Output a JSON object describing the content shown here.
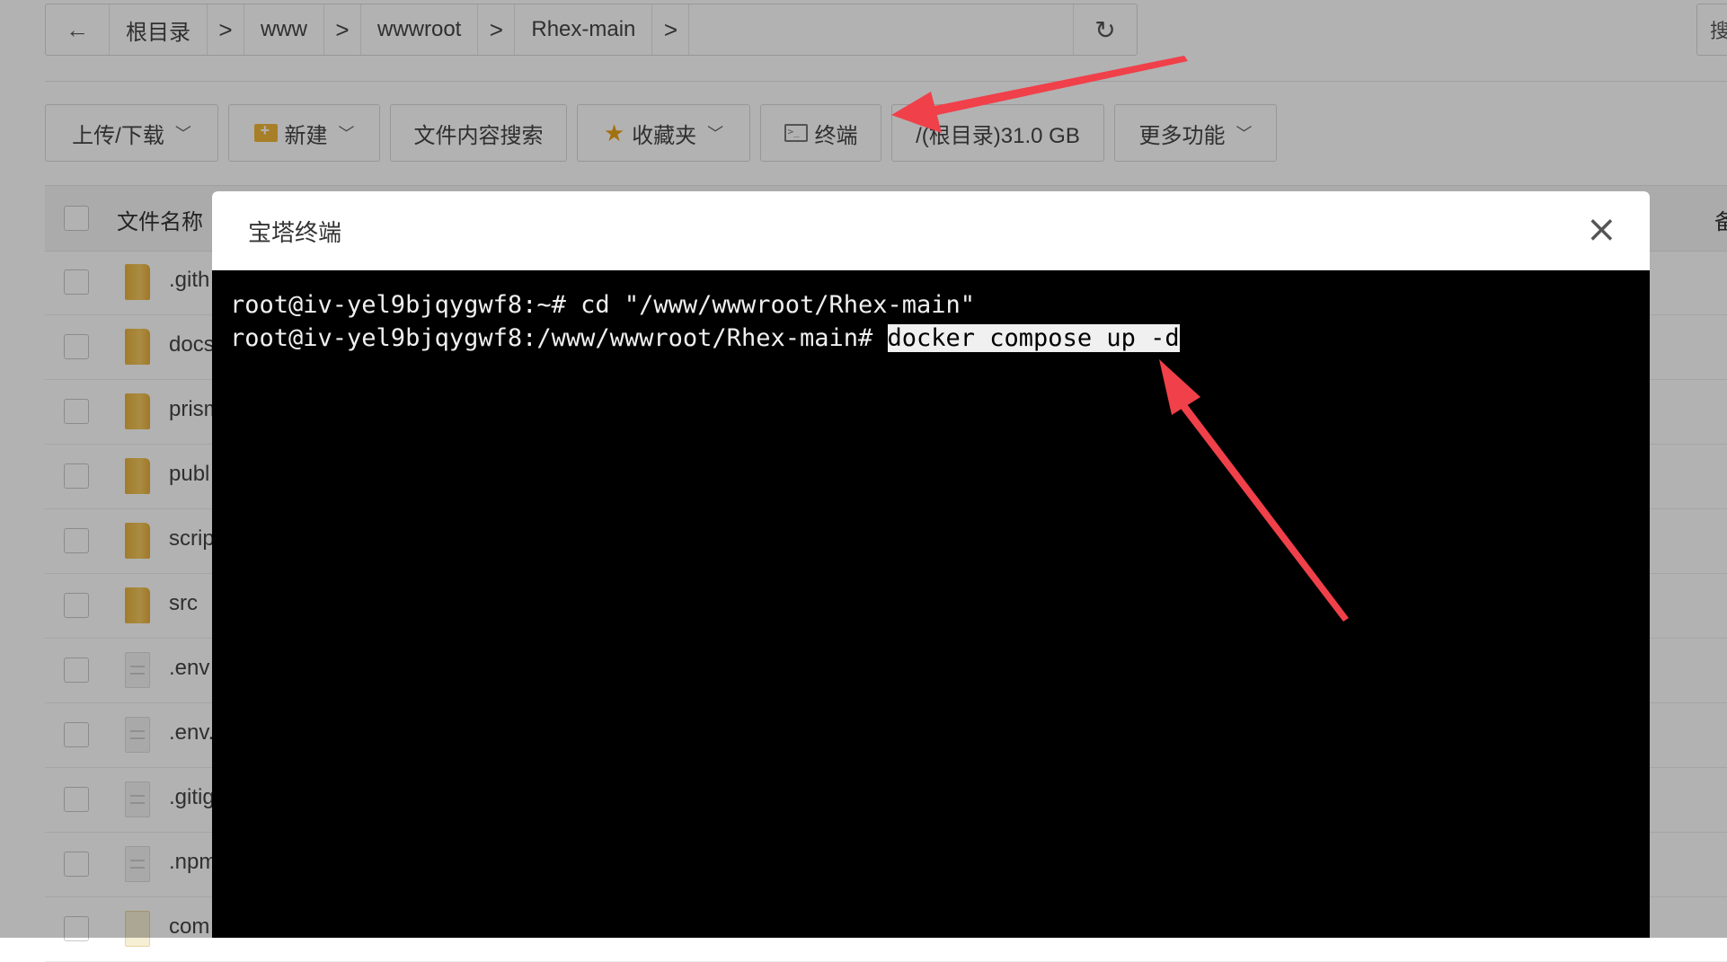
{
  "breadcrumb": {
    "back_icon": "arrow-left-icon",
    "items": [
      "根目录",
      "www",
      "wwwroot",
      "Rhex-main"
    ],
    "sep": ">",
    "refresh_icon": "refresh-icon",
    "right_partial": "搜"
  },
  "toolbar": {
    "upload": "上传/下载",
    "new": "新建",
    "search_content": "文件内容搜索",
    "favorites": "收藏夹",
    "terminal": "终端",
    "disk": "/(根目录)31.0 GB",
    "more": "更多功能",
    "caret": "﹀"
  },
  "table": {
    "header_name": "文件名称",
    "header_right": "备",
    "rows": [
      {
        "name": ".gith",
        "type": "folder"
      },
      {
        "name": "docs",
        "type": "folder"
      },
      {
        "name": "prism",
        "type": "folder"
      },
      {
        "name": "publ",
        "type": "folder"
      },
      {
        "name": "scrip",
        "type": "folder"
      },
      {
        "name": "src",
        "type": "folder"
      },
      {
        "name": ".env",
        "type": "file"
      },
      {
        "name": ".env.",
        "type": "file"
      },
      {
        "name": ".gitig",
        "type": "file"
      },
      {
        "name": ".npm",
        "type": "file"
      },
      {
        "name": "com",
        "type": "code"
      }
    ]
  },
  "modal": {
    "title": "宝塔终端",
    "close": "×",
    "line1": "root@iv-yel9bjqygwf8:~# cd \"/www/wwwroot/Rhex-main\"",
    "line2_prompt": "root@iv-yel9bjqygwf8:/www/wwwroot/Rhex-main# ",
    "line2_cmd": "docker compose up -d"
  },
  "colors": {
    "annotation_arrow": "#f0404a",
    "folder": "#f0b73a",
    "overlay": "rgba(0,0,0,0.3)"
  }
}
